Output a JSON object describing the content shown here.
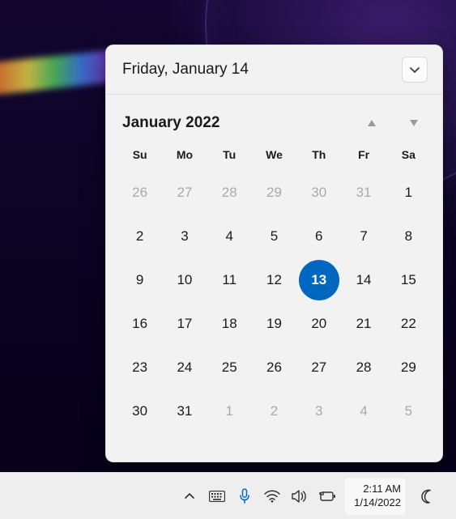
{
  "colors": {
    "accent": "#0067c0",
    "panel_bg": "#f2f2f2",
    "taskbar_bg": "#eeeeee",
    "text": "#1a1a1a",
    "muted": "#a9a9a9"
  },
  "calendar": {
    "header_date": "Friday, January 14",
    "month_label": "January 2022",
    "collapse_icon": "chevron-down-icon",
    "prev_icon": "triangle-up-icon",
    "next_icon": "triangle-down-icon",
    "dow": [
      "Su",
      "Mo",
      "Tu",
      "We",
      "Th",
      "Fr",
      "Sa"
    ],
    "today_index": 18,
    "days": [
      {
        "n": "26",
        "out": true
      },
      {
        "n": "27",
        "out": true
      },
      {
        "n": "28",
        "out": true
      },
      {
        "n": "29",
        "out": true
      },
      {
        "n": "30",
        "out": true
      },
      {
        "n": "31",
        "out": true
      },
      {
        "n": "1",
        "out": false
      },
      {
        "n": "2",
        "out": false
      },
      {
        "n": "3",
        "out": false
      },
      {
        "n": "4",
        "out": false
      },
      {
        "n": "5",
        "out": false
      },
      {
        "n": "6",
        "out": false
      },
      {
        "n": "7",
        "out": false
      },
      {
        "n": "8",
        "out": false
      },
      {
        "n": "9",
        "out": false
      },
      {
        "n": "10",
        "out": false
      },
      {
        "n": "11",
        "out": false
      },
      {
        "n": "12",
        "out": false
      },
      {
        "n": "13",
        "out": false
      },
      {
        "n": "14",
        "out": false
      },
      {
        "n": "15",
        "out": false
      },
      {
        "n": "16",
        "out": false
      },
      {
        "n": "17",
        "out": false
      },
      {
        "n": "18",
        "out": false
      },
      {
        "n": "19",
        "out": false
      },
      {
        "n": "20",
        "out": false
      },
      {
        "n": "21",
        "out": false
      },
      {
        "n": "22",
        "out": false
      },
      {
        "n": "23",
        "out": false
      },
      {
        "n": "24",
        "out": false
      },
      {
        "n": "25",
        "out": false
      },
      {
        "n": "26",
        "out": false
      },
      {
        "n": "27",
        "out": false
      },
      {
        "n": "28",
        "out": false
      },
      {
        "n": "29",
        "out": false
      },
      {
        "n": "30",
        "out": false
      },
      {
        "n": "31",
        "out": false
      },
      {
        "n": "1",
        "out": true
      },
      {
        "n": "2",
        "out": true
      },
      {
        "n": "3",
        "out": true
      },
      {
        "n": "4",
        "out": true
      },
      {
        "n": "5",
        "out": true
      }
    ]
  },
  "taskbar": {
    "overflow_icon": "chevron-up-icon",
    "keyboard_icon": "keyboard-icon",
    "mic_icon": "microphone-icon",
    "wifi_icon": "wifi-icon",
    "volume_icon": "volume-icon",
    "battery_icon": "battery-charging-icon",
    "time": "2:11 AM",
    "date": "1/14/2022",
    "focus_icon": "moon-icon"
  }
}
